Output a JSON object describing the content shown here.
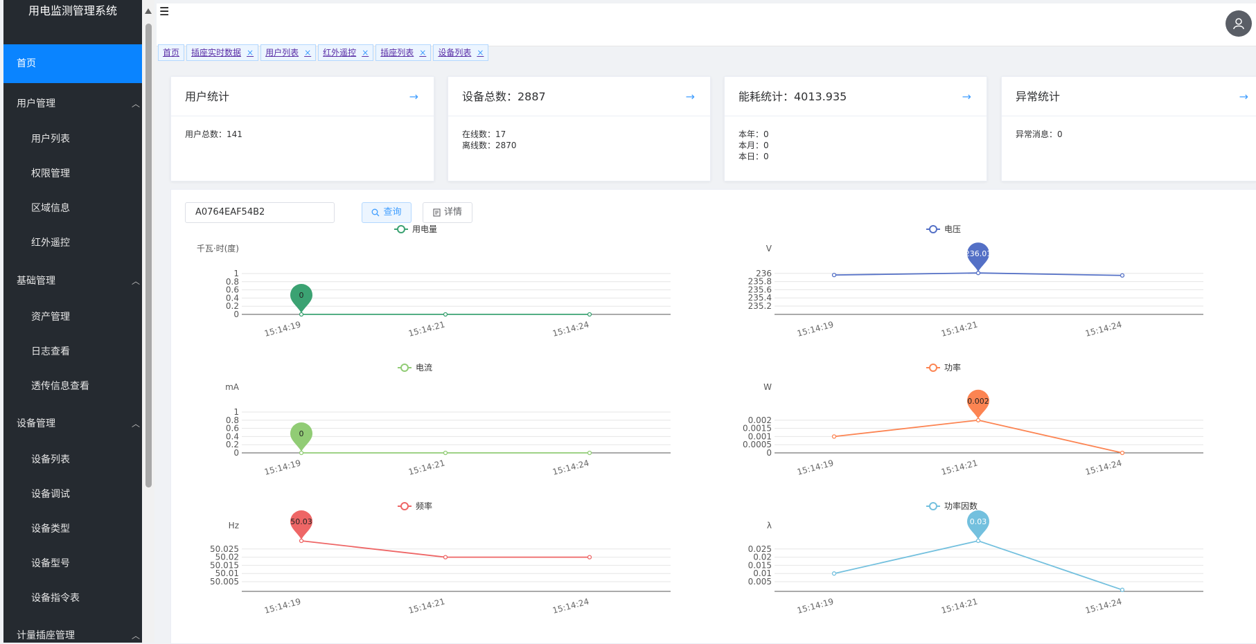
{
  "app_title": "用电监测管理系统",
  "sidebar": {
    "home": "首页",
    "groups": [
      {
        "label": "用户管理",
        "items": [
          "用户列表",
          "权限管理",
          "区域信息",
          "红外遥控"
        ]
      },
      {
        "label": "基础管理",
        "items": [
          "资产管理",
          "日志查看",
          "透传信息查看"
        ]
      },
      {
        "label": "设备管理",
        "items": [
          "设备列表",
          "设备调试",
          "设备类型",
          "设备型号",
          "设备指令表"
        ]
      },
      {
        "label": "计量插座管理",
        "items": []
      }
    ]
  },
  "tabs": [
    {
      "label": "首页",
      "closable": false
    },
    {
      "label": "插座实时数据",
      "closable": true
    },
    {
      "label": "用户列表",
      "closable": true
    },
    {
      "label": "红外遥控",
      "closable": true
    },
    {
      "label": "插座列表",
      "closable": true
    },
    {
      "label": "设备列表",
      "closable": true
    }
  ],
  "cards": [
    {
      "title": "用户统计",
      "lines": [
        "用户总数：141"
      ]
    },
    {
      "title": "设备总数：2887",
      "lines": [
        "在线数：17",
        "离线数：2870"
      ]
    },
    {
      "title": "能耗统计：4013.935",
      "lines": [
        "本年：0",
        "本月：0",
        "本日：0"
      ]
    },
    {
      "title": "异常统计",
      "lines": [
        "异常消息：0"
      ]
    }
  ],
  "search": {
    "value": "A0764EAF54B2"
  },
  "buttons": {
    "query": "查询",
    "detail": "详情"
  },
  "icons": {
    "menu": "menu-icon",
    "avatar": "user-icon",
    "arrow": "arrow-right-icon",
    "search": "search-icon",
    "document": "document-icon",
    "close": "close-icon",
    "caret": "chevron-up-icon"
  },
  "chart_data": [
    {
      "type": "line",
      "series": [
        {
          "name": "用电量",
          "values": [
            0,
            0,
            0
          ]
        }
      ],
      "x": [
        "15:14:19",
        "15:14:21",
        "15:14:24"
      ],
      "ylabel": "千瓦·时(度)",
      "ylim": [
        0,
        1
      ],
      "yticks": [
        "0",
        "0.2",
        "0.4",
        "0.6",
        "0.8",
        "1"
      ],
      "max_label": "0",
      "max_index": 0,
      "color": "#3ba272"
    },
    {
      "type": "line",
      "series": [
        {
          "name": "电压",
          "values": [
            235.96,
            236.01,
            235.95
          ]
        }
      ],
      "x": [
        "15:14:19",
        "15:14:21",
        "15:14:24"
      ],
      "ylabel": "V",
      "ylim": [
        235.1,
        236.1
      ],
      "yticks": [
        "235.2",
        "235.4",
        "235.6",
        "235.8",
        "236"
      ],
      "max_label": "236.01",
      "max_index": 1,
      "color": "#5470c6"
    },
    {
      "type": "line",
      "series": [
        {
          "name": "电流",
          "values": [
            0,
            0,
            0
          ]
        }
      ],
      "x": [
        "15:14:19",
        "15:14:21",
        "15:14:24"
      ],
      "ylabel": "mA",
      "ylim": [
        0,
        1
      ],
      "yticks": [
        "0",
        "0.2",
        "0.4",
        "0.6",
        "0.8",
        "1"
      ],
      "max_label": "0",
      "max_index": 0,
      "color": "#91cc75"
    },
    {
      "type": "line",
      "series": [
        {
          "name": "功率",
          "values": [
            0.001,
            0.002,
            0
          ]
        }
      ],
      "x": [
        "15:14:19",
        "15:14:21",
        "15:14:24"
      ],
      "ylabel": "W",
      "ylim": [
        0,
        0.002
      ],
      "yticks": [
        "0",
        "0.0005",
        "0.001",
        "0.0015",
        "0.002"
      ],
      "max_label": "0.002",
      "max_index": 1,
      "color": "#fc8452"
    },
    {
      "type": "line",
      "series": [
        {
          "name": "频率",
          "values": [
            50.03,
            50.02,
            50.02
          ]
        }
      ],
      "x": [
        "15:14:19",
        "15:14:21",
        "15:14:24"
      ],
      "ylabel": "Hz",
      "ylim": [
        50,
        50.03
      ],
      "yticks": [
        "50.005",
        "50.01",
        "50.015",
        "50.02",
        "50.025"
      ],
      "max_label": "50.03",
      "max_index": 0,
      "color": "#ee6666"
    },
    {
      "type": "line",
      "series": [
        {
          "name": "功率因数",
          "values": [
            0.01,
            0.03,
            0
          ]
        }
      ],
      "x": [
        "15:14:19",
        "15:14:21",
        "15:14:24"
      ],
      "ylabel": "λ",
      "ylim": [
        0,
        0.03
      ],
      "yticks": [
        "0.005",
        "0.01",
        "0.015",
        "0.02",
        "0.025"
      ],
      "max_label": "0.03",
      "max_index": 1,
      "color": "#73c0de"
    }
  ]
}
